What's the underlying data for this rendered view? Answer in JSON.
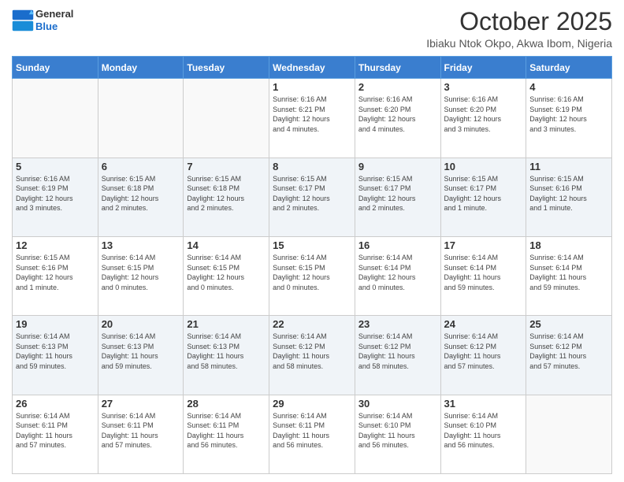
{
  "header": {
    "logo_line1": "General",
    "logo_line2": "Blue",
    "month": "October 2025",
    "location": "Ibiaku Ntok Okpo, Akwa Ibom, Nigeria"
  },
  "days_of_week": [
    "Sunday",
    "Monday",
    "Tuesday",
    "Wednesday",
    "Thursday",
    "Friday",
    "Saturday"
  ],
  "weeks": [
    [
      {
        "day": "",
        "info": ""
      },
      {
        "day": "",
        "info": ""
      },
      {
        "day": "",
        "info": ""
      },
      {
        "day": "1",
        "info": "Sunrise: 6:16 AM\nSunset: 6:21 PM\nDaylight: 12 hours\nand 4 minutes."
      },
      {
        "day": "2",
        "info": "Sunrise: 6:16 AM\nSunset: 6:20 PM\nDaylight: 12 hours\nand 4 minutes."
      },
      {
        "day": "3",
        "info": "Sunrise: 6:16 AM\nSunset: 6:20 PM\nDaylight: 12 hours\nand 3 minutes."
      },
      {
        "day": "4",
        "info": "Sunrise: 6:16 AM\nSunset: 6:19 PM\nDaylight: 12 hours\nand 3 minutes."
      }
    ],
    [
      {
        "day": "5",
        "info": "Sunrise: 6:16 AM\nSunset: 6:19 PM\nDaylight: 12 hours\nand 3 minutes."
      },
      {
        "day": "6",
        "info": "Sunrise: 6:15 AM\nSunset: 6:18 PM\nDaylight: 12 hours\nand 2 minutes."
      },
      {
        "day": "7",
        "info": "Sunrise: 6:15 AM\nSunset: 6:18 PM\nDaylight: 12 hours\nand 2 minutes."
      },
      {
        "day": "8",
        "info": "Sunrise: 6:15 AM\nSunset: 6:17 PM\nDaylight: 12 hours\nand 2 minutes."
      },
      {
        "day": "9",
        "info": "Sunrise: 6:15 AM\nSunset: 6:17 PM\nDaylight: 12 hours\nand 2 minutes."
      },
      {
        "day": "10",
        "info": "Sunrise: 6:15 AM\nSunset: 6:17 PM\nDaylight: 12 hours\nand 1 minute."
      },
      {
        "day": "11",
        "info": "Sunrise: 6:15 AM\nSunset: 6:16 PM\nDaylight: 12 hours\nand 1 minute."
      }
    ],
    [
      {
        "day": "12",
        "info": "Sunrise: 6:15 AM\nSunset: 6:16 PM\nDaylight: 12 hours\nand 1 minute."
      },
      {
        "day": "13",
        "info": "Sunrise: 6:14 AM\nSunset: 6:15 PM\nDaylight: 12 hours\nand 0 minutes."
      },
      {
        "day": "14",
        "info": "Sunrise: 6:14 AM\nSunset: 6:15 PM\nDaylight: 12 hours\nand 0 minutes."
      },
      {
        "day": "15",
        "info": "Sunrise: 6:14 AM\nSunset: 6:15 PM\nDaylight: 12 hours\nand 0 minutes."
      },
      {
        "day": "16",
        "info": "Sunrise: 6:14 AM\nSunset: 6:14 PM\nDaylight: 12 hours\nand 0 minutes."
      },
      {
        "day": "17",
        "info": "Sunrise: 6:14 AM\nSunset: 6:14 PM\nDaylight: 11 hours\nand 59 minutes."
      },
      {
        "day": "18",
        "info": "Sunrise: 6:14 AM\nSunset: 6:14 PM\nDaylight: 11 hours\nand 59 minutes."
      }
    ],
    [
      {
        "day": "19",
        "info": "Sunrise: 6:14 AM\nSunset: 6:13 PM\nDaylight: 11 hours\nand 59 minutes."
      },
      {
        "day": "20",
        "info": "Sunrise: 6:14 AM\nSunset: 6:13 PM\nDaylight: 11 hours\nand 59 minutes."
      },
      {
        "day": "21",
        "info": "Sunrise: 6:14 AM\nSunset: 6:13 PM\nDaylight: 11 hours\nand 58 minutes."
      },
      {
        "day": "22",
        "info": "Sunrise: 6:14 AM\nSunset: 6:12 PM\nDaylight: 11 hours\nand 58 minutes."
      },
      {
        "day": "23",
        "info": "Sunrise: 6:14 AM\nSunset: 6:12 PM\nDaylight: 11 hours\nand 58 minutes."
      },
      {
        "day": "24",
        "info": "Sunrise: 6:14 AM\nSunset: 6:12 PM\nDaylight: 11 hours\nand 57 minutes."
      },
      {
        "day": "25",
        "info": "Sunrise: 6:14 AM\nSunset: 6:12 PM\nDaylight: 11 hours\nand 57 minutes."
      }
    ],
    [
      {
        "day": "26",
        "info": "Sunrise: 6:14 AM\nSunset: 6:11 PM\nDaylight: 11 hours\nand 57 minutes."
      },
      {
        "day": "27",
        "info": "Sunrise: 6:14 AM\nSunset: 6:11 PM\nDaylight: 11 hours\nand 57 minutes."
      },
      {
        "day": "28",
        "info": "Sunrise: 6:14 AM\nSunset: 6:11 PM\nDaylight: 11 hours\nand 56 minutes."
      },
      {
        "day": "29",
        "info": "Sunrise: 6:14 AM\nSunset: 6:11 PM\nDaylight: 11 hours\nand 56 minutes."
      },
      {
        "day": "30",
        "info": "Sunrise: 6:14 AM\nSunset: 6:10 PM\nDaylight: 11 hours\nand 56 minutes."
      },
      {
        "day": "31",
        "info": "Sunrise: 6:14 AM\nSunset: 6:10 PM\nDaylight: 11 hours\nand 56 minutes."
      },
      {
        "day": "",
        "info": ""
      }
    ]
  ]
}
